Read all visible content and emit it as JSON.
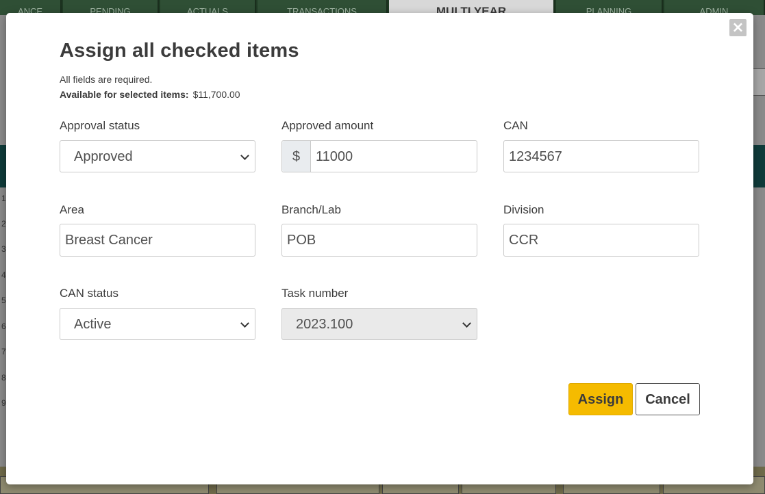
{
  "background": {
    "nav_tabs": [
      "ANCE",
      "PENDING",
      "ACTUALS",
      "TRANSACTIONS",
      "MULTI YEAR",
      "PLANNING",
      "ADMIN"
    ],
    "row_numbers": [
      "1",
      "2",
      "3",
      "4",
      "5",
      "6",
      "7",
      "8",
      "9"
    ]
  },
  "modal": {
    "title": "Assign all checked items",
    "note": "All fields are required.",
    "available_label": "Available for selected items:",
    "available_value": "$11,700.00",
    "close_label": "×",
    "fields": {
      "approval_status": {
        "label": "Approval status",
        "value": "Approved"
      },
      "approved_amount": {
        "label": "Approved amount",
        "prefix": "$",
        "value": "11000"
      },
      "can": {
        "label": "CAN",
        "value": "1234567"
      },
      "area": {
        "label": "Area",
        "value": "Breast Cancer"
      },
      "branch_lab": {
        "label": "Branch/Lab",
        "value": "POB"
      },
      "division": {
        "label": "Division",
        "value": "CCR"
      },
      "can_status": {
        "label": "CAN status",
        "value": "Active"
      },
      "task_number": {
        "label": "Task number",
        "value": "2023.100"
      }
    },
    "assign_label": "Assign",
    "cancel_label": "Cancel"
  },
  "colors": {
    "accent": "#f5bb00",
    "nav_background": "#1f3a24",
    "text": "#3b3b3b"
  }
}
